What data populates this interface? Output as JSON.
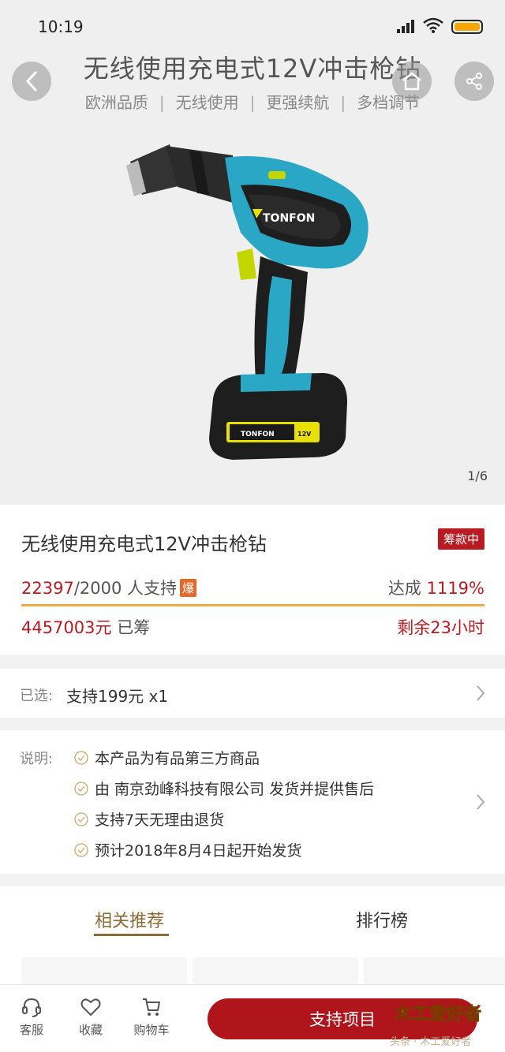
{
  "status_bar": {
    "time": "10:19"
  },
  "hero": {
    "title": "无线使用充电式12V冲击枪钻",
    "features": [
      "欧洲品质",
      "无线使用",
      "更强续航",
      "多档调节"
    ],
    "separator": "|",
    "brand_on_product": "TONFON",
    "battery_label": "12V",
    "pager": "1/6"
  },
  "product": {
    "title": "无线使用充电式12V冲击枪钻",
    "status_tag": "筹款中",
    "supporters_count": "22397",
    "supporters_target": "/2000 人支持",
    "hot_badge": "爆",
    "achieve_label": "达成",
    "achieve_percent": "1119%",
    "raised_amount": "4457003元",
    "raised_label": "已筹",
    "remaining": "剩余23小时",
    "progress_fraction": 1.0
  },
  "selection": {
    "label": "已选:",
    "value": "支持199元 x1"
  },
  "notes": {
    "label": "说明:",
    "items": [
      "本产品为有品第三方商品",
      "由 南京劲峰科技有限公司 发货并提供售后",
      "支持7天无理由退货",
      "预计2018年8月4日起开始发货"
    ]
  },
  "tabs": {
    "recommend": "相关推荐",
    "ranking": "排行榜"
  },
  "bottom_bar": {
    "service": "客服",
    "favorite": "收藏",
    "cart": "购物车",
    "support_button": "支持项目"
  },
  "watermark": {
    "logo": "木工爱好者",
    "sub": "头条 · 木工爱好者"
  },
  "colors": {
    "accent_red": "#b0151b",
    "gold": "#8a6a35",
    "progress": "#f0a848",
    "drill_teal": "#2aa7c4"
  }
}
